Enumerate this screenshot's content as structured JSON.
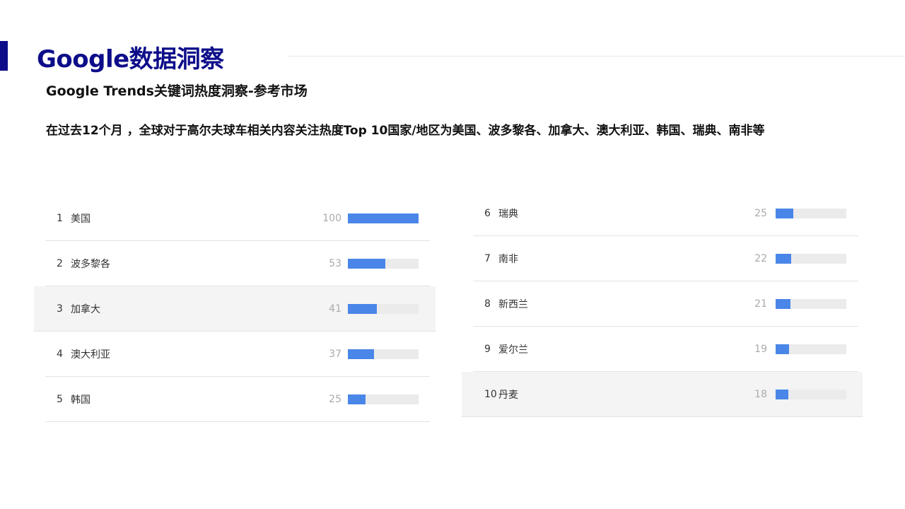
{
  "header": {
    "title": "Google数据洞察",
    "subtitle": "Google Trends关键词热度洞察-参考市场",
    "description": "在过去12个月 ，全球对于高尔夫球车相关内容关注热度Top 10国家/地区为美国、波多黎各、加拿大、澳大利亚、韩国、瑞典、南非等"
  },
  "colors": {
    "accent": "#0d0d8a",
    "bar": "#4a86e8",
    "track": "#ebebeb",
    "highlight_row": "#f4f4f4"
  },
  "chart_data": {
    "type": "bar",
    "title": "",
    "xlabel": "",
    "ylabel": "",
    "ylim": [
      0,
      100
    ],
    "categories": [
      "美国",
      "波多黎各",
      "加拿大",
      "澳大利亚",
      "韩国",
      "瑞典",
      "南非",
      "新西兰",
      "爱尔兰",
      "丹麦"
    ],
    "values": [
      100,
      53,
      41,
      37,
      25,
      25,
      22,
      21,
      19,
      18
    ],
    "ranks": [
      "1",
      "2",
      "3",
      "4",
      "5",
      "6",
      "7",
      "8",
      "9",
      "10"
    ],
    "columns": [
      {
        "start": 0,
        "end": 5,
        "highlight_index": 2
      },
      {
        "start": 5,
        "end": 10,
        "highlight_index": 4
      }
    ]
  }
}
